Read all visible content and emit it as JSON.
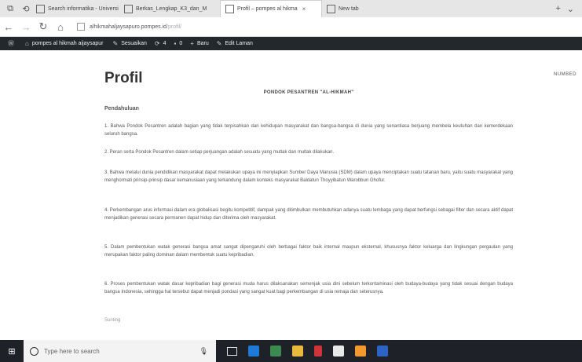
{
  "browser": {
    "tabs": [
      {
        "label": "Search informatika - Universi",
        "icon": "page-icon",
        "active": false
      },
      {
        "label": "Berkas_Lengkap_K3_dan_M",
        "icon": "document-icon",
        "active": false
      },
      {
        "label": "Profil – pompes al hikma",
        "icon": "page-icon",
        "active": true
      },
      {
        "label": "New tab",
        "icon": "page-icon",
        "active": false
      }
    ],
    "new_tab_symbol": "+",
    "tab_close_symbol": "×",
    "url_host": "alhikmahaljaysapuro.pompes.id",
    "url_path": "/profil/"
  },
  "wp_admin_bar": {
    "site_name": "pompes al hikmah aijaysapur",
    "customize": "Sesuaikan",
    "comments_count": "4",
    "new_count": "0",
    "new_label": "Baru",
    "edit_label": "Edit Laman"
  },
  "page": {
    "title": "Profil",
    "number_label": "NUMBED",
    "doc_title": "PONDOK PESANTREN \"AL-HIKMAH\"",
    "section_heading": "Pendahuluan",
    "paragraphs": [
      "1. Bahwa Pondok Pesantren adalah bagian yang tidak terpisahkan dari kehidupan masyarakat dan bangsa-bangsa di dunia yang senantiasa berjuang membela keutuhan dan kemerdekaan seluruh bangsa.",
      "2. Peran serta Pondok Pesantren dalam setiap perjuangan adalah sesuatu yang mutlak dan multak dilakukan.",
      "3. Bahwa melalui dunia pendidikan masyarakat dapat melakukan upaya ini menyiapkan Sumber Daya Manusia (SDM) dalam upaya menciptakan suatu tatanan baru, yaitu suatu masyarakat yang menghormati prinsip-prinsip dasar kemanusiaan yang terkandung dalam konteks masyarakat Baldatun Thoyyibatun Warobbun Ghofur.",
      "4. Perkembangan arus informasi dalam era globalisasi begitu kompetitif, dampak yang ditimbulkan membutuhkan adanya suatu lembaga yang dapat berfungsi sebagai filter dan secara aktif dapat menjadikan generasi secara permanen dapat hidup dan diterima oleh masyarakat.",
      "5. Dalam pembentukan watak generasi bangsa amat sangat dipengaruhi oleh berbagai faktor baik internal maupun eksternal, khususnya faktor keluarga dan lingkungan pergaulan yang merupakan faktor paling dominan dalam membentuk suatu kepribadian.",
      "6. Proses pembentukan watak dasar kepribadian bagi generasi muda harus dilaksanakan semenjak usia dini sebelum terkontaminasi oleh budaya-budaya yang tidak sesuai dengan budaya bangsa Indonesia, sehingga hal tersebut dapat menjadi pondasi yang sangat kuat bagi perkembangan di usia remaja dan seterusnya."
    ],
    "footer_word": "Sunting"
  },
  "taskbar": {
    "search_placeholder": "Type here to search"
  },
  "colors": {
    "wp_bar": "#23282d",
    "taskbar": "#1f2129",
    "tab_strip": "#e6e6e6"
  }
}
